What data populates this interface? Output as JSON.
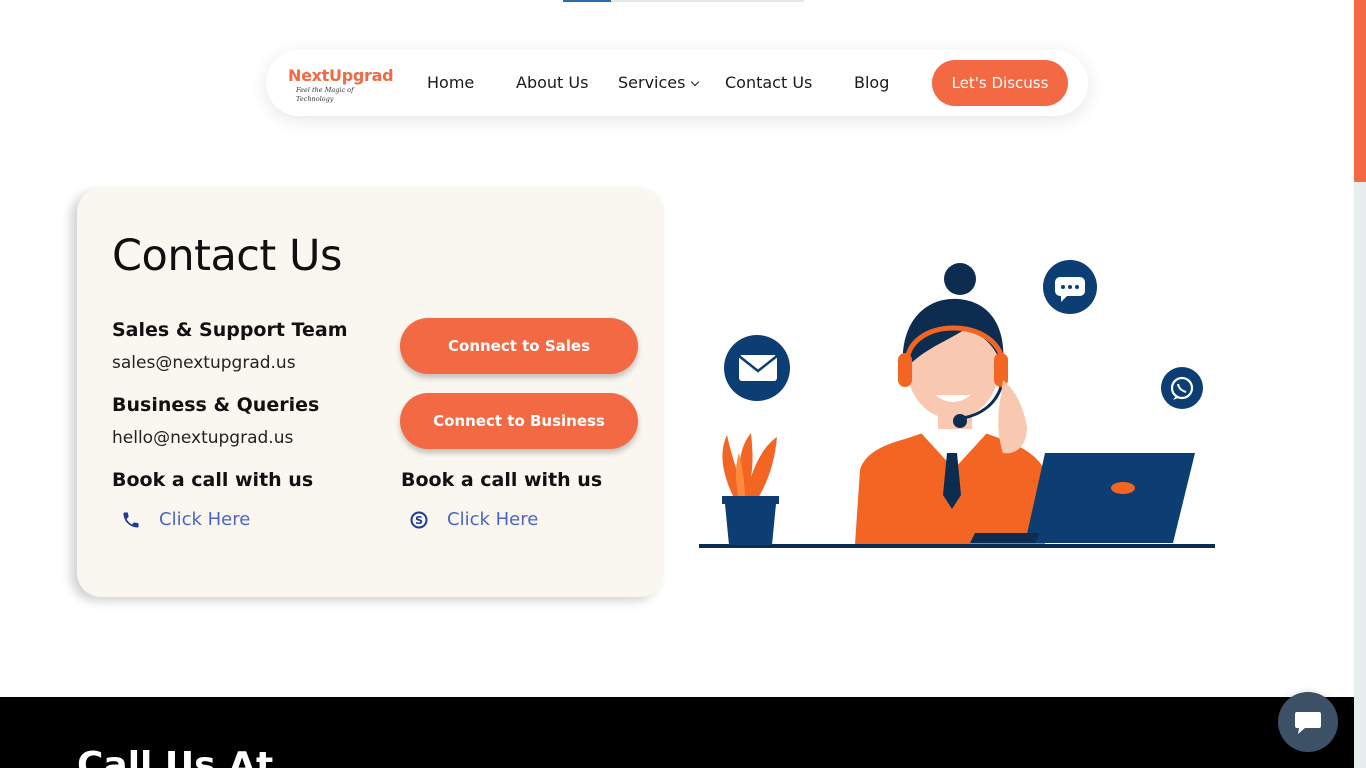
{
  "nav": {
    "logo": {
      "brand": "NextUpgrad",
      "tagline": "Feel the Magic of Technology"
    },
    "items": [
      {
        "label": "Home"
      },
      {
        "label": "About Us"
      },
      {
        "label": "Services"
      },
      {
        "label": "Contact Us"
      },
      {
        "label": "Blog"
      }
    ],
    "cta": "Let's Discuss"
  },
  "contact": {
    "title": "Contact Us",
    "sales": {
      "label": "Sales & Support Team",
      "email": "sales@nextupgrad.us",
      "button": "Connect to Sales"
    },
    "business": {
      "label": "Business & Queries",
      "email": "hello@nextupgrad.us",
      "button": "Connect to Business"
    },
    "book_phone": {
      "label": "Book a call with us",
      "link": "Click Here",
      "icon": "phone-icon"
    },
    "book_skype": {
      "label": "Book a call with us",
      "link": "Click Here",
      "icon": "skype-icon"
    }
  },
  "footer": {
    "heading": "Call Us At"
  },
  "colors": {
    "accent": "#f26944",
    "navy": "#0c3e73",
    "link": "#4a66c2",
    "card_bg": "#faf6f0"
  }
}
